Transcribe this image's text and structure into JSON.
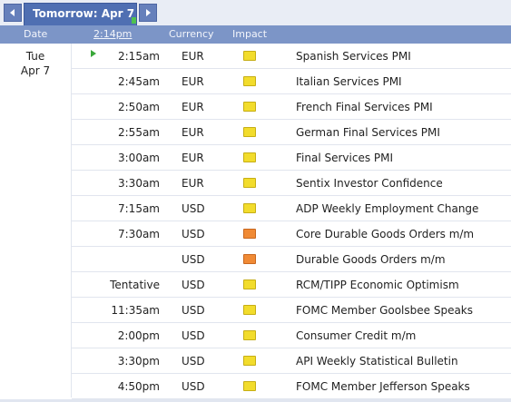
{
  "tab": {
    "label": "Tomorrow: Apr 7"
  },
  "columns": {
    "date": "Date",
    "time": "2:14pm",
    "currency": "Currency",
    "impact": "Impact"
  },
  "date": {
    "day": "Tue",
    "date": "Apr 7"
  },
  "impact_colors": {
    "low": "#f2dc2c",
    "medium": "#f08a35"
  },
  "events": [
    {
      "time": "2:15am",
      "currency": "EUR",
      "impact": "low",
      "title": "Spanish Services PMI",
      "upnext": true
    },
    {
      "time": "2:45am",
      "currency": "EUR",
      "impact": "low",
      "title": "Italian Services PMI"
    },
    {
      "time": "2:50am",
      "currency": "EUR",
      "impact": "low",
      "title": "French Final Services PMI"
    },
    {
      "time": "2:55am",
      "currency": "EUR",
      "impact": "low",
      "title": "German Final Services PMI"
    },
    {
      "time": "3:00am",
      "currency": "EUR",
      "impact": "low",
      "title": "Final Services PMI"
    },
    {
      "time": "3:30am",
      "currency": "EUR",
      "impact": "low",
      "title": "Sentix Investor Confidence"
    },
    {
      "time": "7:15am",
      "currency": "USD",
      "impact": "low",
      "title": "ADP Weekly Employment Change"
    },
    {
      "time": "7:30am",
      "currency": "USD",
      "impact": "medium",
      "title": "Core Durable Goods Orders m/m"
    },
    {
      "time": "",
      "currency": "USD",
      "impact": "medium",
      "title": "Durable Goods Orders m/m"
    },
    {
      "time": "Tentative",
      "currency": "USD",
      "impact": "low",
      "title": "RCM/TIPP Economic Optimism"
    },
    {
      "time": "11:35am",
      "currency": "USD",
      "impact": "low",
      "title": "FOMC Member Goolsbee Speaks"
    },
    {
      "time": "2:00pm",
      "currency": "USD",
      "impact": "low",
      "title": "Consumer Credit m/m"
    },
    {
      "time": "3:30pm",
      "currency": "USD",
      "impact": "low",
      "title": "API Weekly Statistical Bulletin"
    },
    {
      "time": "4:50pm",
      "currency": "USD",
      "impact": "low",
      "title": "FOMC Member Jefferson Speaks"
    }
  ]
}
